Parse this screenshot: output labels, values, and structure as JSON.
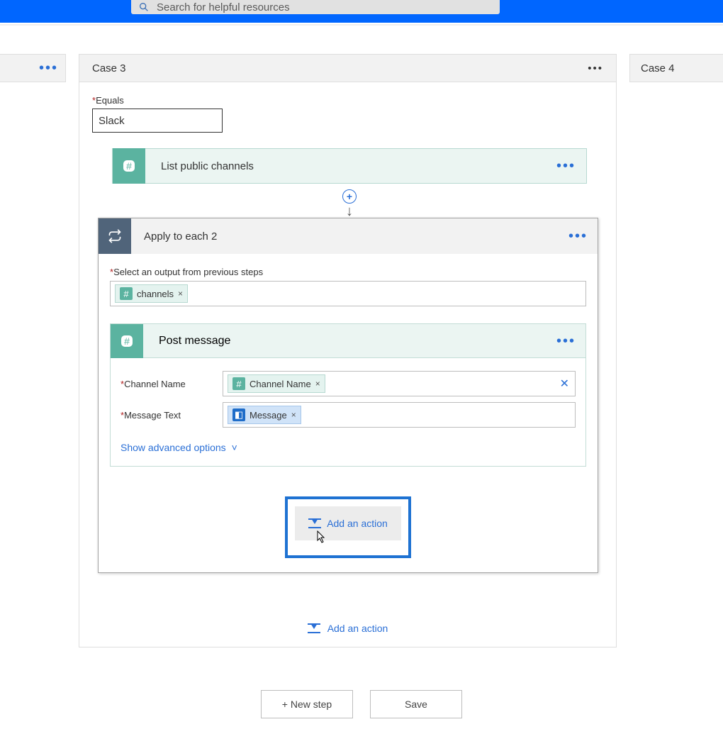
{
  "search": {
    "placeholder": "Search for helpful resources"
  },
  "cases": {
    "left_overflow": "…",
    "main": {
      "title": "Case 3"
    },
    "right": {
      "title": "Case 4"
    }
  },
  "equals": {
    "label": "Equals",
    "value": "Slack"
  },
  "listChannels": {
    "title": "List public channels"
  },
  "applyEach": {
    "title": "Apply to each 2",
    "selectLabel": "Select an output from previous steps",
    "token": {
      "label": "channels"
    }
  },
  "postMessage": {
    "title": "Post message",
    "channelName": {
      "label": "Channel Name",
      "token": "Channel Name"
    },
    "messageText": {
      "label": "Message Text",
      "token": "Message"
    },
    "advanced": "Show advanced options"
  },
  "addAction": "Add an action",
  "footer": {
    "newStep": "+ New step",
    "save": "Save"
  }
}
